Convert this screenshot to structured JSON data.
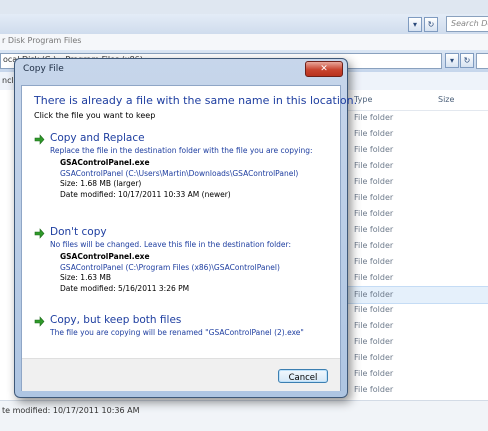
{
  "background": {
    "search_placeholder": "Search Do",
    "address_text": "ocal Disk (C:) ▸ Program Files (x86) ▸",
    "address_faint": "r          Disk       Program Files",
    "toolbar_text": "nclu",
    "columns": {
      "type": "Type",
      "size": "Size"
    },
    "rows": [
      "File folder",
      "File folder",
      "File folder",
      "File folder",
      "File folder",
      "File folder",
      "File folder",
      "File folder",
      "File folder",
      "File folder",
      "File folder",
      "File folder",
      "File folder",
      "File folder",
      "File folder",
      "File folder",
      "File folder",
      "File folder"
    ],
    "selected_row_index": 11,
    "status_text": "te modified: 10/17/2011 10:36 AM"
  },
  "dialog": {
    "title": "Copy File",
    "close_label": "✕",
    "heading": "There is already a file with the same name in this location.",
    "subheading": "Click the file you want to keep",
    "options": [
      {
        "title": "Copy and Replace",
        "description": "Replace the file in the destination folder with the file you are copying:",
        "file_name": "GSAControlPanel.exe",
        "file_path": "GSAControlPanel (C:\\Users\\Martin\\Downloads\\GSAControlPanel)",
        "size": "Size: 1.68 MB (larger)",
        "date": "Date modified: 10/17/2011 10:33 AM (newer)"
      },
      {
        "title": "Don't copy",
        "description": "No files will be changed. Leave this file in the destination folder:",
        "file_name": "GSAControlPanel.exe",
        "file_path": "GSAControlPanel (C:\\Program Files (x86)\\GSAControlPanel)",
        "size": "Size: 1.63 MB",
        "date": "Date modified: 5/16/2011 3:26 PM"
      },
      {
        "title": "Copy, but keep both files",
        "description": "The file you are copying will be renamed \"GSAControlPanel (2).exe\""
      }
    ],
    "cancel_label": "Cancel"
  }
}
